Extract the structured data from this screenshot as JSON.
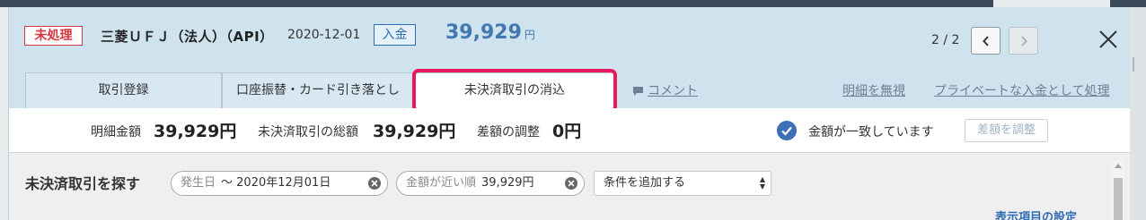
{
  "transaction": {
    "status": "未処理",
    "account": "三菱ＵＦＪ（法人）（API）",
    "date": "2020-12-01",
    "type": "入金",
    "amount": "39,929",
    "amount_unit": "円"
  },
  "pager": {
    "text": "2 / 2"
  },
  "tabs": [
    {
      "label": "取引登録"
    },
    {
      "label": "口座振替・カード引き落とし"
    },
    {
      "label": "未決済取引の消込"
    }
  ],
  "links": {
    "comment": "コメント",
    "ignore": "明細を無視",
    "private_deposit": "プライベートな入金として処理"
  },
  "summary": {
    "detail_amount_label": "明細金額",
    "detail_amount_value": "39,929円",
    "unsettled_total_label": "未決済取引の総額",
    "unsettled_total_value": "39,929円",
    "adjust_diff_label": "差額の調整",
    "adjust_diff_value": "0円",
    "match_status": "金額が一致しています",
    "adjust_button": "差額を調整"
  },
  "search": {
    "title": "未決済取引を探す",
    "filters": [
      {
        "key": "発生日",
        "value": "〜 2020年12月01日"
      },
      {
        "key": "金額が近い順",
        "value": "39,929円"
      }
    ],
    "add_condition": "条件を追加する",
    "display_settings": "表示項目の設定"
  },
  "colors": {
    "header_bg": "#cfe3ef",
    "status_red": "#d9363e",
    "amount_blue": "#4577b0",
    "highlight": "#e8185e",
    "check_blue": "#3c6fb6"
  },
  "icons": {
    "prev": "chevron-left-icon",
    "next": "chevron-right-icon",
    "close": "close-icon",
    "comment": "comment-icon",
    "match": "check-circle-icon",
    "clear": "clear-filter-icon"
  }
}
